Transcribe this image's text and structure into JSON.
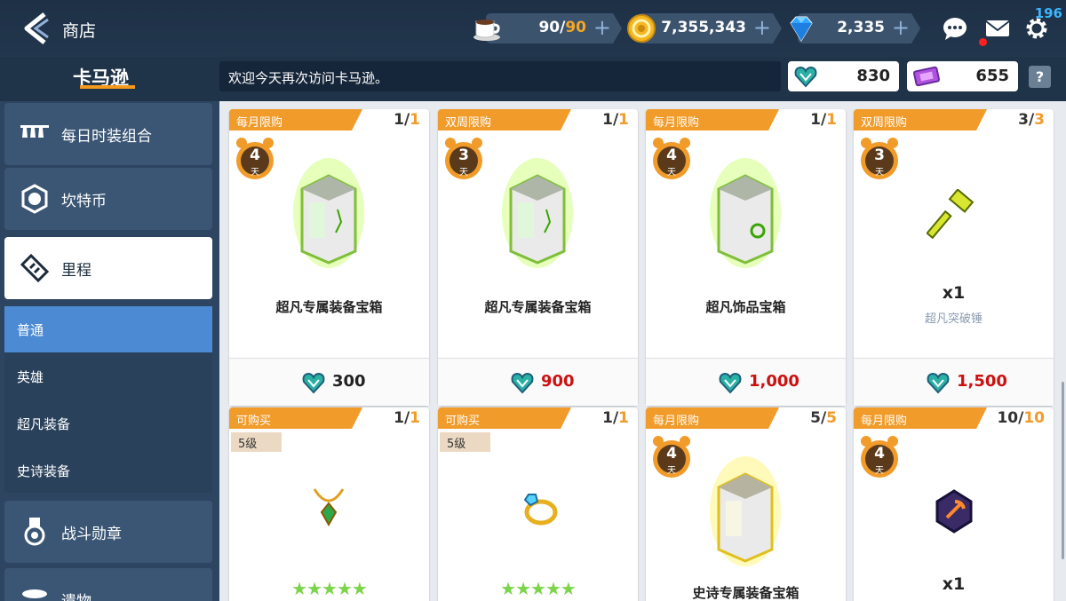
{
  "header": {
    "title": "商店",
    "stamina": {
      "current": "90",
      "sep": "/",
      "max": "90"
    },
    "gold": "7,355,343",
    "gems": "2,335",
    "level": "196"
  },
  "subheader": {
    "tab_title": "卡马逊",
    "notice": "欢迎今天再次访问卡马逊。",
    "currency_a": "830",
    "currency_b": "655",
    "help": "?"
  },
  "sidebar": {
    "items": [
      {
        "label": "每日时装组合"
      },
      {
        "label": "坎特币"
      },
      {
        "label": "里程"
      },
      {
        "label": "战斗勋章"
      },
      {
        "label": "遗物"
      }
    ],
    "sub_items": [
      {
        "label": "普通"
      },
      {
        "label": "英雄"
      },
      {
        "label": "超凡装备"
      },
      {
        "label": "史诗装备"
      }
    ]
  },
  "cards": [
    {
      "band": "每月限购",
      "count_cur": "1",
      "count_max": "1",
      "days": "4",
      "day_unit": "天",
      "name": "超凡专属装备宝箱",
      "price": "300",
      "price_color": "#222222"
    },
    {
      "band": "双周限购",
      "count_cur": "1",
      "count_max": "1",
      "days": "3",
      "day_unit": "天",
      "name": "超凡专属装备宝箱",
      "price": "900",
      "price_color": "#cc1111"
    },
    {
      "band": "每月限购",
      "count_cur": "1",
      "count_max": "1",
      "days": "4",
      "day_unit": "天",
      "name": "超凡饰品宝箱",
      "price": "1,000",
      "price_color": "#cc1111"
    },
    {
      "band": "双周限购",
      "count_cur": "3",
      "count_max": "3",
      "days": "3",
      "day_unit": "天",
      "qty": "x1",
      "sub": "超凡突破锤",
      "price": "1,500",
      "price_color": "#cc1111"
    },
    {
      "band": "可购买",
      "count_cur": "1",
      "count_max": "1",
      "level": "5级",
      "stars": "★★★★★"
    },
    {
      "band": "可购买",
      "count_cur": "1",
      "count_max": "1",
      "level": "5级",
      "stars": "★★★★★"
    },
    {
      "band": "每月限购",
      "count_cur": "5",
      "count_max": "5",
      "days": "4",
      "day_unit": "天",
      "name": "史诗专属装备宝箱"
    },
    {
      "band": "每月限购",
      "count_cur": "10",
      "count_max": "10",
      "days": "4",
      "day_unit": "天",
      "qty": "x1"
    }
  ],
  "colors": {
    "accent": "#f19b2a",
    "sidebar_active": "#4c8bd4",
    "price_red": "#cc1111"
  }
}
